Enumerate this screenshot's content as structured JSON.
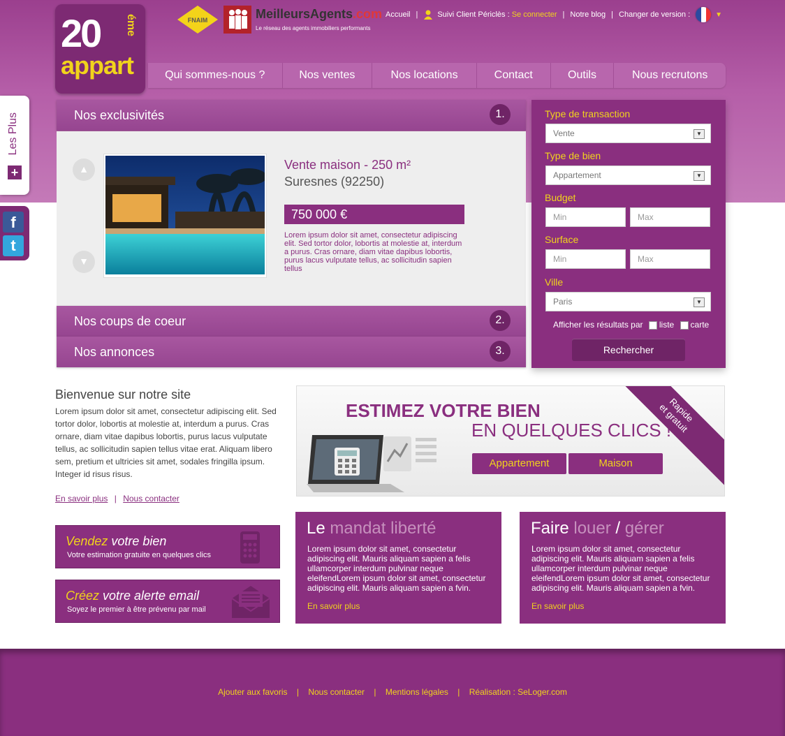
{
  "logo": {
    "number": "20",
    "suffix": "éme",
    "word": "appart"
  },
  "partners": {
    "fnaim": "FNAIM",
    "ma_title": "MeilleursAgents",
    "ma_com": ".com",
    "ma_sub": "Le réseau des agents immobiliers performants"
  },
  "topnav": {
    "accueil": "Accueil",
    "suivi": "Suivi Client Périclès :",
    "connect": "Se connecter",
    "blog": "Notre blog",
    "version": "Changer de version :"
  },
  "mainnav": [
    "Qui sommes-nous ?",
    "Nos ventes",
    "Nos locations",
    "Contact",
    "Outils",
    "Nous recrutons"
  ],
  "lesplus": {
    "label": "Les Plus",
    "plus": "+"
  },
  "accordion": [
    {
      "title": "Nos exclusivités",
      "num": "1."
    },
    {
      "title": "Nos coups de coeur",
      "num": "2."
    },
    {
      "title": "Nos annonces",
      "num": "3."
    }
  ],
  "listing": {
    "title": "Vente maison - 250 m²",
    "city": "Suresnes (92250)",
    "price": "750 000 €",
    "desc": "Lorem ipsum dolor sit amet, consectetur adipiscing elit. Sed tortor dolor, lobortis at molestie at, interdum a purus. Cras ornare, diam vitae dapibus lobortis, purus lacus vulputate tellus, ac sollicitudin sapien tellus"
  },
  "search": {
    "transaction_label": "Type de transaction",
    "transaction_value": "Vente",
    "bien_label": "Type de bien",
    "bien_value": "Appartement",
    "budget_label": "Budget",
    "budget_min": "Min",
    "budget_max": "Max",
    "surface_label": "Surface",
    "surface_min": "Min",
    "surface_max": "Max",
    "ville_label": "Ville",
    "ville_value": "Paris",
    "afficher": "Afficher les résultats par",
    "liste": "liste",
    "carte": "carte",
    "button": "Rechercher"
  },
  "welcome": {
    "title": "Bienvenue sur notre site",
    "text": "Lorem ipsum dolor sit amet, consectetur adipiscing elit. Sed tortor dolor, lobortis at molestie at, interdum a purus. Cras ornare, diam vitae dapibus lobortis, purus lacus vulputate tellus, ac sollicitudin sapien tellus vitae erat. Aliquam libero sem, pretium et ultricies sit amet, sodales fringilla ipsum. Integer id risus risus.",
    "link1": "En savoir plus",
    "link2": "Nous contacter"
  },
  "estimate": {
    "line1": "ESTIMEZ VOTRE BIEN",
    "line2": "EN QUELQUES CLICS !",
    "btn1": "Appartement",
    "btn2": "Maison",
    "ribbon1": "Rapide",
    "ribbon2": "et gratuit"
  },
  "sidebtns": [
    {
      "accent": "Vendez",
      "rest": " votre bien",
      "sub": "Votre estimation gratuite en quelques clics"
    },
    {
      "accent": "Créez",
      "rest": " votre alerte email",
      "sub": "Soyez le premier à être prévenu par mail"
    }
  ],
  "cards": [
    {
      "h1": "Le ",
      "h2": "mandat liberté",
      "h3": "",
      "h4": "",
      "text": "Lorem ipsum dolor sit amet, consectetur adipiscing elit. Mauris aliquam sapien a felis ullamcorper interdum pulvinar neque eleifendLorem ipsum dolor sit amet, consectetur adipiscing elit. Mauris aliquam sapien a fvin.",
      "link": "En savoir plus"
    },
    {
      "h1": "Faire ",
      "h2": "louer",
      "h3": " / ",
      "h4": "gérer",
      "text": "Lorem ipsum dolor sit amet, consectetur adipiscing elit. Mauris aliquam sapien a felis ullamcorper interdum pulvinar neque eleifendLorem ipsum dolor sit amet, consectetur adipiscing elit. Mauris aliquam sapien a fvin.",
      "link": "En savoir plus"
    }
  ],
  "footer": [
    "Ajouter aux favoris",
    "Nous contacter",
    "Mentions légales",
    "Réalisation : SeLoger.com"
  ],
  "separator": "|",
  "colors": {
    "brand": "#8a2f7f",
    "accent": "#f1d31c"
  }
}
